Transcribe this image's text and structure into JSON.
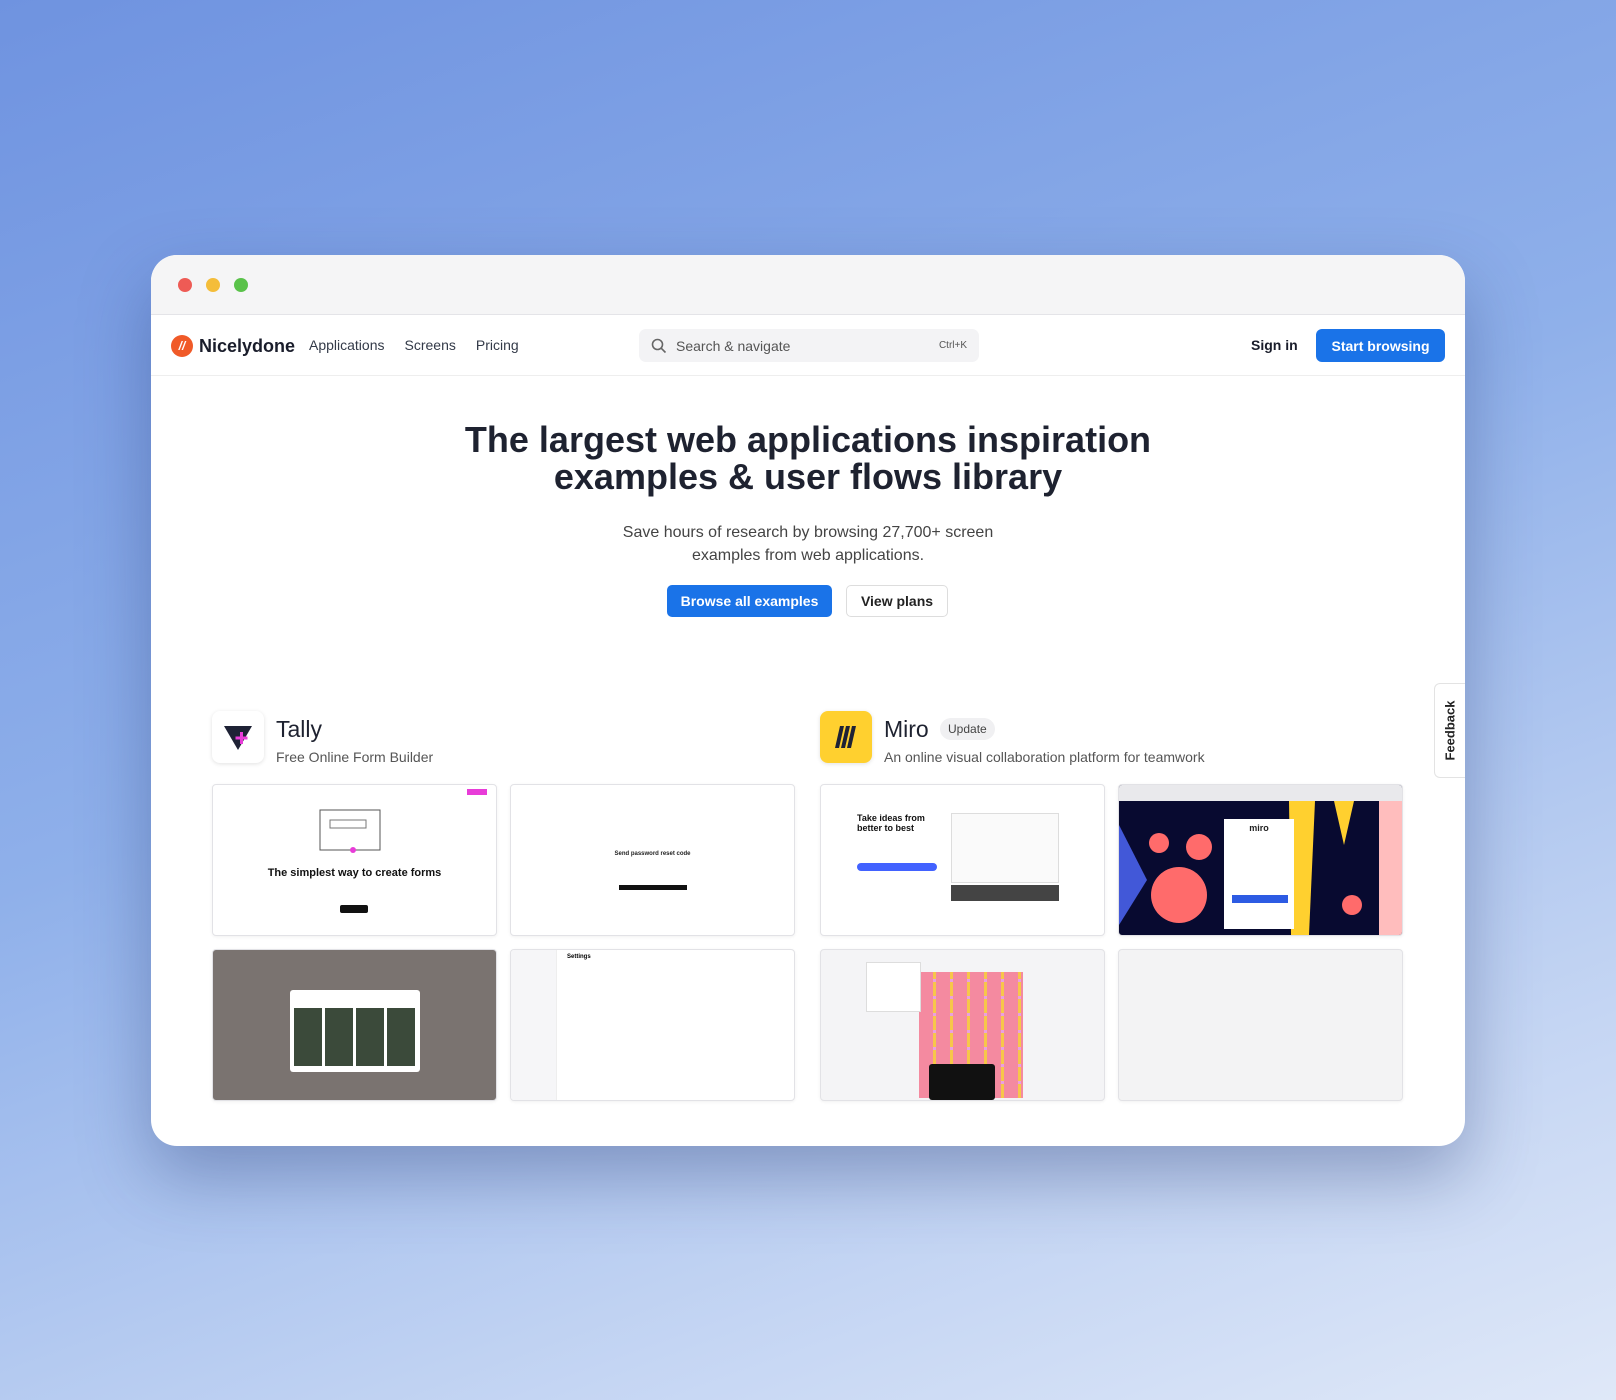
{
  "window": {
    "controls": [
      "close",
      "minimize",
      "zoom"
    ]
  },
  "nav": {
    "brand": "Nicelydone",
    "links": [
      "Applications",
      "Screens",
      "Pricing"
    ],
    "search_placeholder": "Search & navigate",
    "search_shortcut": "Ctrl+K",
    "sign_in": "Sign in",
    "start_browsing": "Start browsing"
  },
  "hero": {
    "title_line1": "The largest web applications inspiration",
    "title_line2": "examples & user flows library",
    "subtitle_line1": "Save hours of research by browsing 27,700+ screen",
    "subtitle_line2": "examples from web applications.",
    "primary_button": "Browse all examples",
    "secondary_button": "View plans"
  },
  "apps": [
    {
      "name": "Tally",
      "description": "Free Online Form Builder",
      "thumbs": {
        "t1_heading": "The simplest way to create forms",
        "t2_heading": "Send password reset code",
        "t4_heading": "Settings"
      }
    },
    {
      "name": "Miro",
      "badge": "Update",
      "description": "An online visual collaboration platform for teamwork",
      "thumbs": {
        "t1_heading": "Take ideas from better to best",
        "logo": "miro"
      }
    }
  ],
  "feedback": "Feedback",
  "colors": {
    "accent": "#1a73e8",
    "brand": "#f05a28",
    "miro_yellow": "#ffd02f",
    "tally_pink": "#e83cd8"
  }
}
